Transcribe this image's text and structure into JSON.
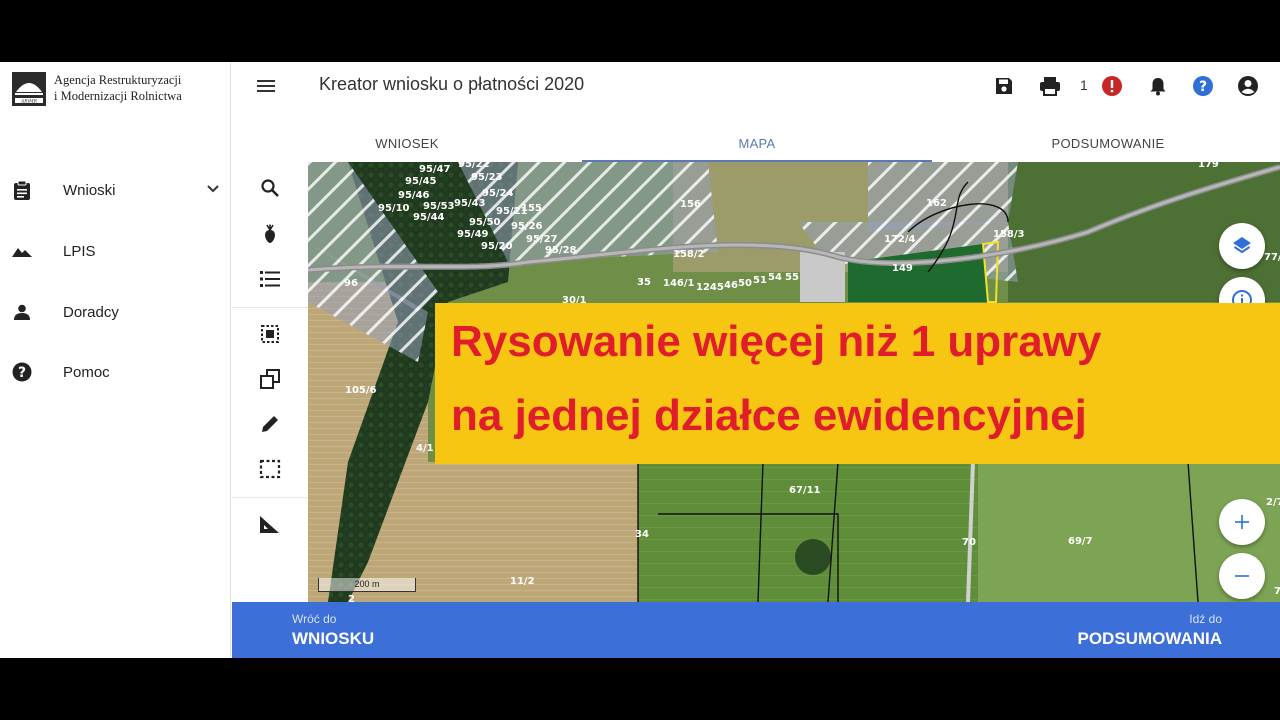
{
  "brand": {
    "line1": "Agencja Restrukturyzacji",
    "line2": "i Modernizacji Rolnictwa",
    "mark_text": "ARiMR"
  },
  "sidebar": {
    "items": [
      {
        "label": "Wnioski",
        "icon": "clipboard-icon"
      },
      {
        "label": "LPIS",
        "icon": "terrain-icon"
      },
      {
        "label": "Doradcy",
        "icon": "person-icon"
      },
      {
        "label": "Pomoc",
        "icon": "help-icon"
      }
    ]
  },
  "header": {
    "title": "Kreator wniosku o płatności 2020",
    "error_count": "1"
  },
  "tabs": [
    {
      "label": "WNIOSEK",
      "active": false
    },
    {
      "label": "MAPA",
      "active": true
    },
    {
      "label": "PODSUMOWANIE",
      "active": false
    }
  ],
  "tools": [
    "search-icon",
    "crop-icon",
    "list-icon",
    "select-all-icon",
    "copy-shapes-icon",
    "pencil-icon",
    "select-rect-icon",
    "measure-icon"
  ],
  "map": {
    "scale_label": "200 m",
    "parcel_labels": {
      "p9547": "95/47",
      "p9522": "95/22",
      "p9545": "95/45",
      "p9523": "95/23",
      "p9546": "95/46",
      "p9524": "95/24",
      "p9510": "95/10",
      "p9553": "95/53",
      "p9543": "95/43",
      "p9521": "95/21",
      "p155": "155",
      "p9544": "95/44",
      "p9550": "95/50",
      "p9526": "95/26",
      "p9549": "95/49",
      "p9527": "95/27",
      "p9520": "95/20",
      "p9528": "95/28",
      "p156": "156",
      "p162": "162",
      "p1724": "172/4",
      "p1583": "158/3",
      "p1582": "158/2",
      "p149": "149",
      "p96": "96",
      "p35": "35",
      "p1461": "146/1",
      "p4": "4",
      "p1245": "1245",
      "p46": "46",
      "p50": "50",
      "p51": "51",
      "p54": "54",
      "p55": "55",
      "p30": "30/1",
      "p1056": "105/6",
      "p41": "4/1",
      "p6711": "67/11",
      "p34": "34",
      "p70": "70",
      "p697": "69/7",
      "p112": "11/2",
      "p2": "2",
      "p77": "77/",
      "p27": "2/7",
      "p74": "74",
      "p179": "179"
    }
  },
  "banner": {
    "line1": "Rysowanie więcej niż 1 uprawy",
    "line2": "na jednej działce ewidencyjnej"
  },
  "footer": {
    "back_small": "Wróć do",
    "back_big": "WNIOSKU",
    "next_small": "Idź do",
    "next_big": "PODSUMOWANIA"
  },
  "colors": {
    "accent": "#3d6fd8",
    "tab_active": "#5d78b5",
    "banner_bg": "#f7c613",
    "banner_text": "#e01d2b",
    "error": "#c62828",
    "help": "#2f6fd6"
  }
}
